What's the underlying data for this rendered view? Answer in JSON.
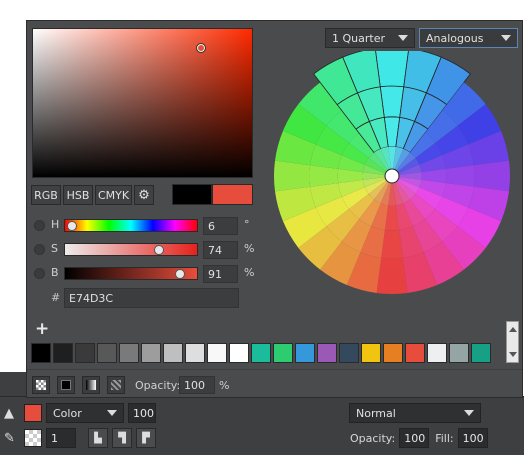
{
  "background_app": {
    "fill_mode": "Color",
    "fill_opacity": "100",
    "brush_size": "1",
    "blend_mode": "Normal",
    "opacity_label": "Opacity:",
    "opacity_value": "100",
    "fill_label": "Fill:",
    "fill_value": "100"
  },
  "picker": {
    "current_color": "#e74d3c",
    "previous_color": "#000000",
    "mode_buttons": [
      "RGB",
      "HSB",
      "CMYK"
    ],
    "channels": [
      {
        "label": "H",
        "value": "6",
        "unit": "°",
        "fraction": 0.03
      },
      {
        "label": "S",
        "value": "74",
        "unit": "%",
        "fraction": 0.74
      },
      {
        "label": "B",
        "value": "91",
        "unit": "%",
        "fraction": 0.91
      }
    ],
    "hex_label": "#",
    "hex_value": "E74D3C",
    "rule_select": "1 Quarter",
    "harmony_select": "Analogous",
    "opacity_label": "Opacity:",
    "opacity_value": "100",
    "opacity_unit": "%",
    "swatches": [
      "#000000",
      "#1f1f1f",
      "#3a3a3a",
      "#585858",
      "#7a7a7a",
      "#9d9d9d",
      "#bfbfbf",
      "#dedede",
      "#f8f8f8",
      "#ffffff",
      "#1abc9c",
      "#2ecc71",
      "#3498db",
      "#9b59b6",
      "#34495e",
      "#f1c40f",
      "#e67e22",
      "#e74c3c",
      "#ecf0f1",
      "#95a5a6",
      "#16a085"
    ]
  }
}
